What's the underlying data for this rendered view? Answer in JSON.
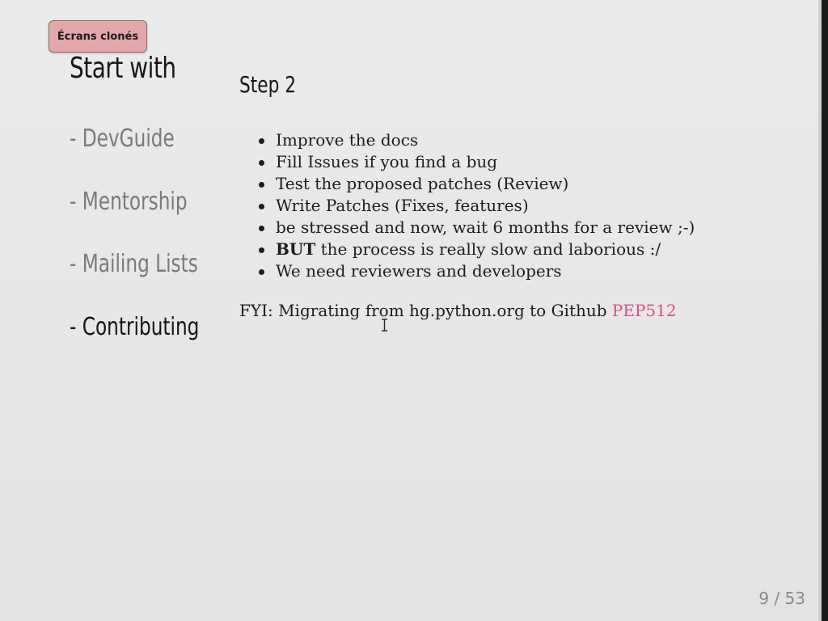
{
  "overlay": {
    "badge_label": "Écrans clonés"
  },
  "sidebar": {
    "title": "Start with",
    "items": [
      {
        "label": "- DevGuide",
        "active": false
      },
      {
        "label": "- Mentorship",
        "active": false
      },
      {
        "label": "- Mailing Lists",
        "active": false
      },
      {
        "label": "- Contributing",
        "active": true
      }
    ]
  },
  "main": {
    "heading": "Step 2",
    "bullets": [
      {
        "bold": "",
        "text": "Improve the docs"
      },
      {
        "bold": "",
        "text": "Fill Issues if you find a bug"
      },
      {
        "bold": "",
        "text": "Test the proposed patches (Review)"
      },
      {
        "bold": "",
        "text": "Write Patches (Fixes, features)"
      },
      {
        "bold": "",
        "text": "be stressed and now, wait 6 months for a review ;-)"
      },
      {
        "bold": "BUT",
        "text": " the process is really slow and laborious :/"
      },
      {
        "bold": "",
        "text": "We need reviewers and developers"
      }
    ],
    "fyi_text": "FYI: Migrating from hg.python.org to Github ",
    "fyi_link": "PEP512"
  },
  "footer": {
    "page_counter": "9 / 53"
  },
  "colors": {
    "link": "#e04a86",
    "badge_bg": "#e2a7a9",
    "inactive_nav": "#7a7a7a",
    "active_nav": "#141414"
  },
  "icons": {
    "cursor": "text-cursor-icon"
  }
}
